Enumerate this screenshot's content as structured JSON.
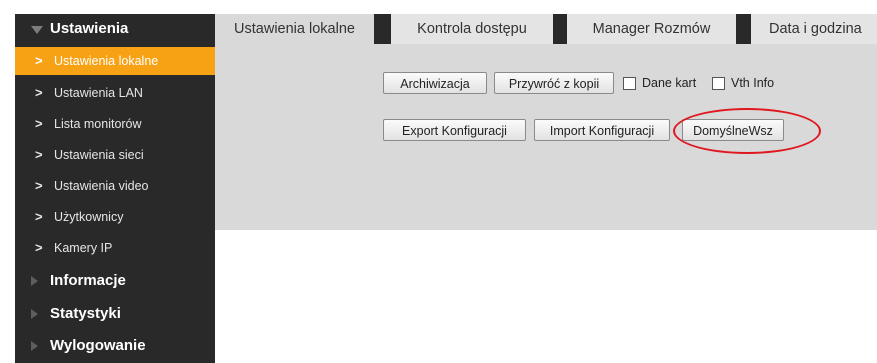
{
  "sidebar": {
    "settings_label": "Ustawienia",
    "items": [
      {
        "label": "Ustawienia lokalne"
      },
      {
        "label": "Ustawienia LAN"
      },
      {
        "label": "Lista monitorów"
      },
      {
        "label": "Ustawienia sieci"
      },
      {
        "label": "Ustawienia video"
      },
      {
        "label": "Użytkownicy"
      },
      {
        "label": "Kamery IP"
      }
    ],
    "chevron_glyph": ">",
    "sections": [
      {
        "label": "Informacje"
      },
      {
        "label": "Statystyki"
      },
      {
        "label": "Wylogowanie"
      }
    ]
  },
  "tabs": [
    {
      "label": "Ustawienia lokalne"
    },
    {
      "label": "Kontrola dostępu"
    },
    {
      "label": "Manager Rozmów"
    },
    {
      "label": "Data i godzina"
    }
  ],
  "buttons": {
    "backup": "Archiwizacja",
    "restore": "Przywróć z kopii",
    "export": "Export Konfiguracji",
    "import": "Import Konfiguracji",
    "defaults": "DomyślneWsz"
  },
  "checkboxes": {
    "card_data": {
      "label": "Dane kart",
      "checked": false
    },
    "vth_info": {
      "label": "Vth Info",
      "checked": false
    }
  },
  "colors": {
    "accent": "#f7a215",
    "sidebar_bg": "#292929",
    "panel_bg": "#d9d9d9",
    "highlight_ring": "#e0171f"
  }
}
